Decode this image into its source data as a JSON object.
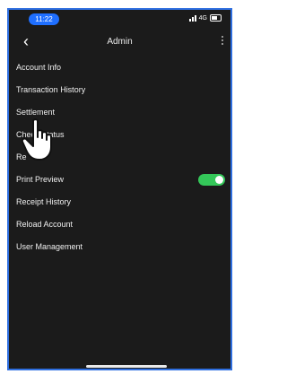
{
  "status_bar": {
    "time": "11:22",
    "network": "4G",
    "accent_color": "#1f6fff"
  },
  "nav": {
    "title": "Admin",
    "back_icon": "chevron-left-icon",
    "more_icon": "vertical-dots-icon"
  },
  "menu": {
    "items": [
      {
        "label": "Account Info"
      },
      {
        "label": "Transaction History"
      },
      {
        "label": "Settlement"
      },
      {
        "label": "Check Status"
      },
      {
        "label": "Re"
      },
      {
        "label": "Print Preview",
        "toggle_on": true
      },
      {
        "label": "Receipt History"
      },
      {
        "label": "Reload Account"
      },
      {
        "label": "User Management"
      }
    ]
  },
  "colors": {
    "background": "#1b1b1b",
    "toggle_on": "#34c759",
    "frame": "#2f6fe0"
  },
  "overlay": {
    "icon": "pointing-hand-icon"
  }
}
